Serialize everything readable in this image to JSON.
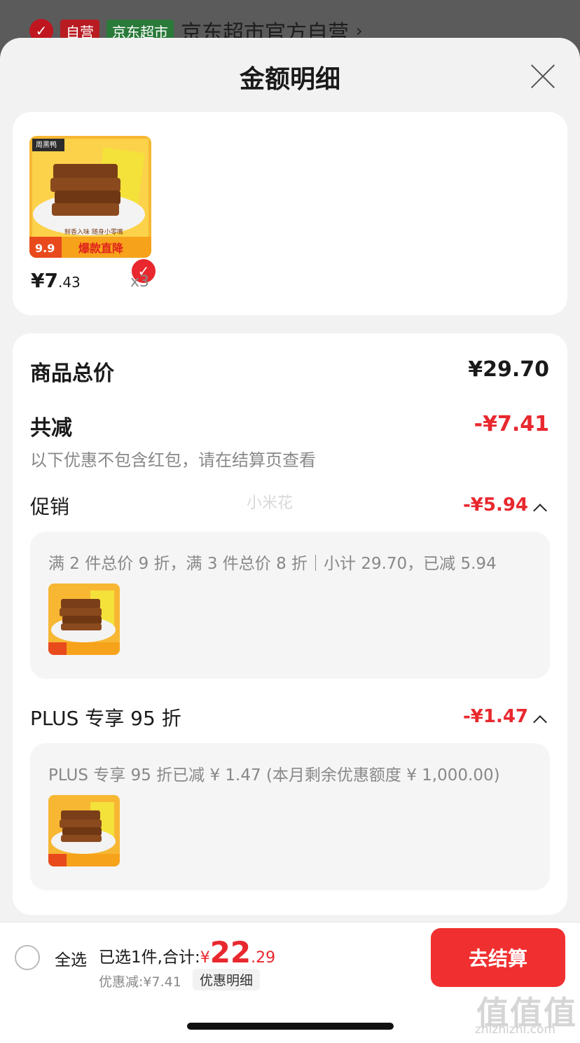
{
  "background_store": {
    "self_tag": "自营",
    "market_tag": "京东超市",
    "name": "京东超市官方自营",
    "arrow": "›"
  },
  "sheet": {
    "title": "金额明细"
  },
  "product": {
    "price_int": "¥7",
    "price_dec": ".43",
    "qty": "x3",
    "image_texts": {
      "brand": "周黑鸭",
      "slogan": "鲜香入味 随身小零嘴",
      "price_badge": "9.9",
      "promo": "爆款直降"
    }
  },
  "totals": {
    "goods_label": "商品总价",
    "goods_value": "¥29.70",
    "reduce_label": "共减",
    "reduce_value": "-¥7.41",
    "note": "以下优惠不包含红包，请在结算页查看"
  },
  "promotion": {
    "label": "促销",
    "value": "-¥5.94",
    "detail": "满 2 件总价 9 折，满 3 件总价 8 折｜小计 29.70，已减 5.94"
  },
  "plus": {
    "label": "PLUS 专享 95 折",
    "value": "-¥1.47",
    "detail": "PLUS 专享 95 折已减 ¥ 1.47 (本月剩余优惠额度 ¥ 1,000.00)"
  },
  "watermark": "小米花",
  "bottom": {
    "select_all": "全选",
    "summary_prefix": "已选1件,合计:",
    "currency": "¥",
    "total_int": "22",
    "total_dec": ".29",
    "discount": "优惠减:¥7.41",
    "detail_link": "优惠明细",
    "checkout": "去结算"
  },
  "site": {
    "logo": "值值值",
    "url": "zhizhizhi.com"
  },
  "colors": {
    "accent": "#e8282e",
    "checkout_bg": "#f03030",
    "sheet_bg": "#f2f2f2"
  }
}
